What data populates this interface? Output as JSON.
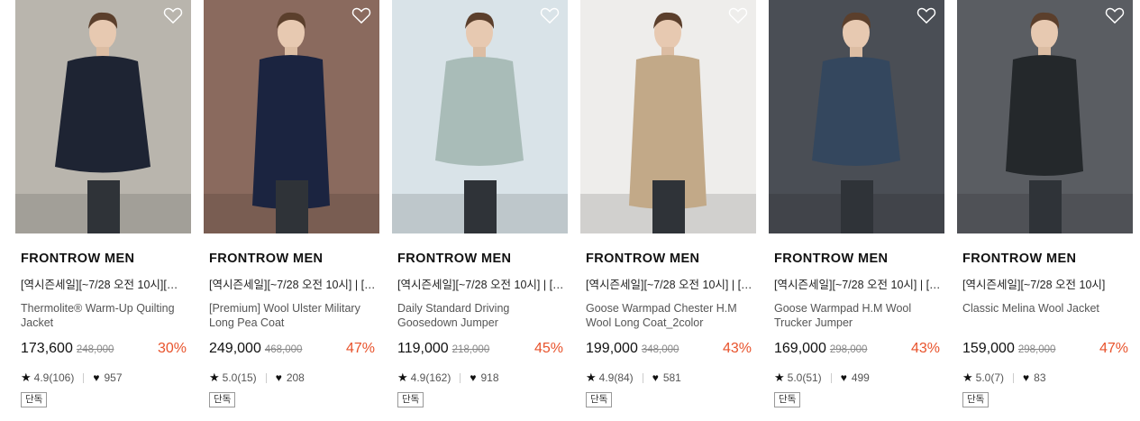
{
  "products": [
    {
      "brand": "FRONTROW MEN",
      "promo": "[역시즌세일][~7/28 오전 10시][기…",
      "name": "Thermolite® Warm-Up Quilting Jacket",
      "price": "173,600",
      "original_price": "248,000",
      "discount": "30%",
      "rating": "4.9(106)",
      "likes": "957",
      "badge": "단독",
      "photo": {
        "bg": "#b9b5ad",
        "garment": "#1e2433",
        "garment_style": "quilted-jacket"
      }
    },
    {
      "brand": "FRONTROW MEN",
      "promo": "[역시즌세일][~7/28 오전 10시] | […",
      "name": "[Premium] Wool Ulster Military Long Pea Coat",
      "price": "249,000",
      "original_price": "468,000",
      "discount": "47%",
      "rating": "5.0(15)",
      "likes": "208",
      "badge": "단독",
      "photo": {
        "bg": "#8a6a5e",
        "garment": "#1b2440",
        "garment_style": "long-coat"
      }
    },
    {
      "brand": "FRONTROW MEN",
      "promo": "[역시즌세일][~7/28 오전 10시] | […",
      "name": "Daily Standard Driving Goosedown Jumper",
      "price": "119,000",
      "original_price": "218,000",
      "discount": "45%",
      "rating": "4.9(162)",
      "likes": "918",
      "badge": "단독",
      "photo": {
        "bg": "#d9e3e8",
        "garment": "#a9bcb8",
        "garment_style": "short-jumper"
      }
    },
    {
      "brand": "FRONTROW MEN",
      "promo": "[역시즌세일][~7/28 오전 10시] | […",
      "name": "Goose Warmpad Chester H.M Wool Long Coat_2color",
      "price": "199,000",
      "original_price": "348,000",
      "discount": "43%",
      "rating": "4.9(84)",
      "likes": "581",
      "badge": "단독",
      "photo": {
        "bg": "#eeedeb",
        "garment": "#c2a988",
        "garment_style": "long-coat"
      }
    },
    {
      "brand": "FRONTROW MEN",
      "promo": "[역시즌세일][~7/28 오전 10시] | […",
      "name": "Goose Warmpad H.M Wool Trucker Jumper",
      "price": "169,000",
      "original_price": "298,000",
      "discount": "43%",
      "rating": "5.0(51)",
      "likes": "499",
      "badge": "단독",
      "photo": {
        "bg": "#4a4e55",
        "garment": "#34475e",
        "garment_style": "short-jumper"
      }
    },
    {
      "brand": "FRONTROW MEN",
      "promo": "[역시즌세일][~7/28 오전 10시]",
      "name": "Classic Melina Wool Jacket",
      "price": "159,000",
      "original_price": "298,000",
      "discount": "47%",
      "rating": "5.0(7)",
      "likes": "83",
      "badge": "단독",
      "photo": {
        "bg": "#5a5d62",
        "garment": "#24282b",
        "garment_style": "blazer"
      }
    }
  ],
  "icons": {
    "wishlist": "heart-outline-icon",
    "rating": "star-icon",
    "likes": "heart-filled-icon"
  },
  "colors": {
    "discount": "#e8532c",
    "text": "#222222",
    "muted": "#888888"
  }
}
